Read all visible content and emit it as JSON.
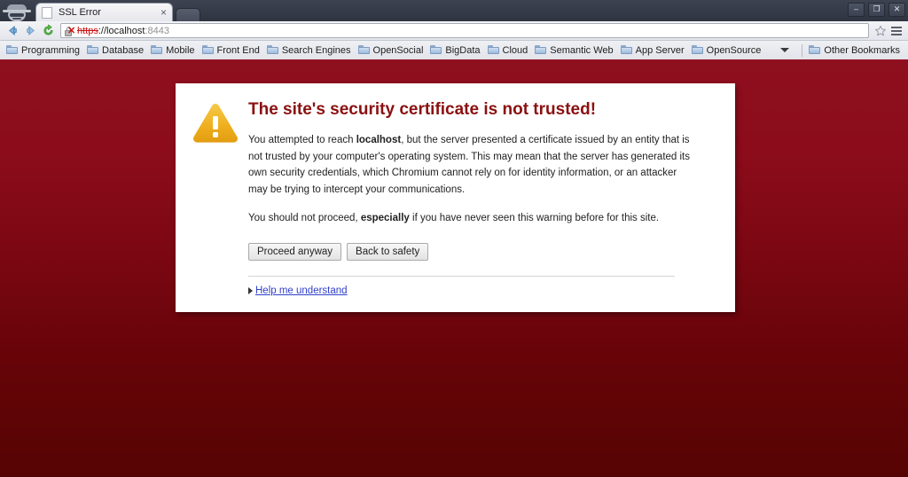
{
  "window": {
    "controls": [
      {
        "name": "minimize",
        "glyph": "–"
      },
      {
        "name": "maximize",
        "glyph": "❐"
      },
      {
        "name": "close",
        "glyph": "✕"
      }
    ]
  },
  "tab": {
    "title": "SSL Error",
    "close_glyph": "×",
    "favicon_name": "blank-page-icon"
  },
  "toolbar": {
    "back_glyph": "←",
    "forward_glyph": "→",
    "reload_glyph": "⟳",
    "star_glyph": "☆",
    "menu_name": "chrome-menu-icon",
    "url": {
      "scheme": "https",
      "host": "://localhost",
      "port": ":8443",
      "security_state": "broken-https"
    }
  },
  "bookmarks": {
    "items": [
      {
        "label": "Programming"
      },
      {
        "label": "Database"
      },
      {
        "label": "Mobile"
      },
      {
        "label": "Front End"
      },
      {
        "label": "Search Engines"
      },
      {
        "label": "OpenSocial"
      },
      {
        "label": "BigData"
      },
      {
        "label": "Cloud"
      },
      {
        "label": "Semantic Web"
      },
      {
        "label": "App Server"
      },
      {
        "label": "OpenSource"
      }
    ],
    "other_bookmarks": "Other Bookmarks"
  },
  "ssl_error": {
    "title": "The site's security certificate is not trusted!",
    "paragraph1_pre": "You attempted to reach ",
    "paragraph1_host": "localhost",
    "paragraph1_post": ", but the server presented a certificate issued by an entity that is not trusted by your computer's operating system. This may mean that the server has generated its own security credentials, which Chromium cannot rely on for identity information, or an attacker may be trying to intercept your communications.",
    "paragraph2_pre": "You should not proceed, ",
    "paragraph2_em": "especially",
    "paragraph2_post": " if you have never seen this warning before for this site.",
    "proceed_label": "Proceed anyway",
    "back_label": "Back to safety",
    "help_link": "Help me understand",
    "icon_name": "warning-triangle-icon"
  },
  "colors": {
    "page_gradient_top": "#8e0f1e",
    "page_gradient_bottom": "#560403",
    "title_red": "#8b1010",
    "warning_amber": "#f0b323",
    "link_blue": "#2f3fcc"
  }
}
